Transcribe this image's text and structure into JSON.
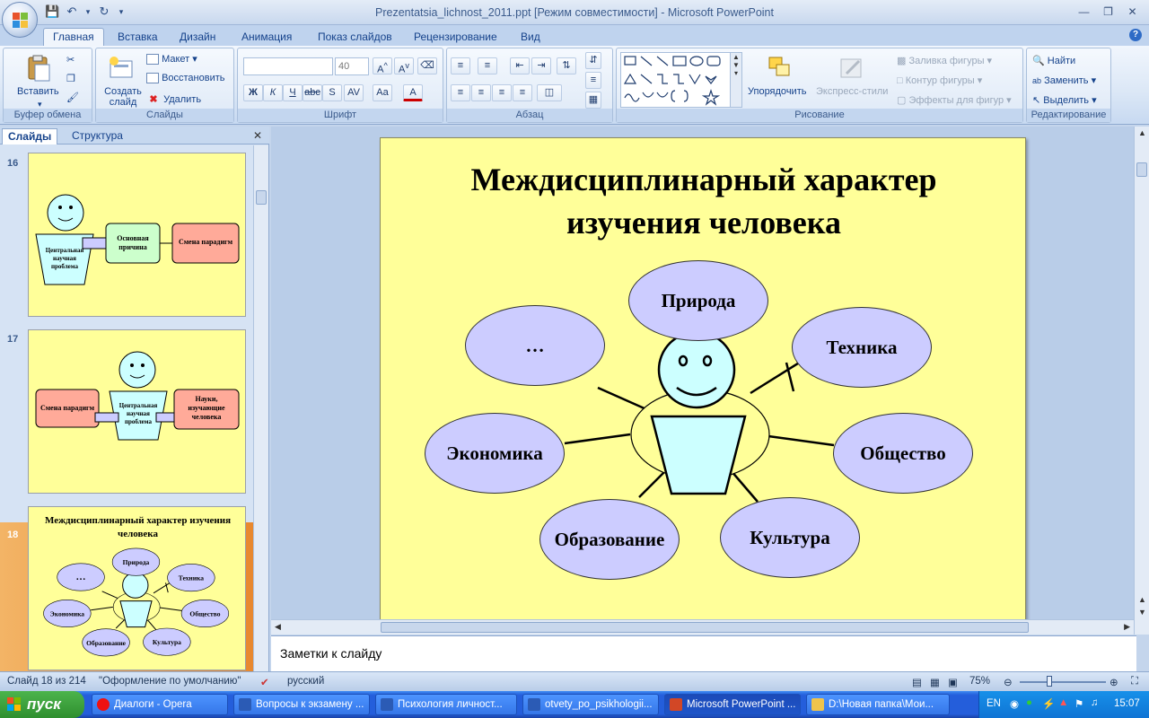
{
  "window": {
    "title": "Prezentatsia_lichnost_2011.ppt [Режим совместимости] - Microsoft PowerPoint"
  },
  "ribbon_tabs": [
    "Главная",
    "Вставка",
    "Дизайн",
    "Анимация",
    "Показ слайдов",
    "Рецензирование",
    "Вид"
  ],
  "ribbon": {
    "clipboard": {
      "paste": "Вставить",
      "label": "Буфер обмена"
    },
    "slides": {
      "new_slide": "Создать слайд",
      "layout": "Макет",
      "reset": "Восстановить",
      "delete": "Удалить",
      "label": "Слайды"
    },
    "font": {
      "font_name": "",
      "font_size": "40",
      "label": "Шрифт"
    },
    "paragraph": {
      "label": "Абзац"
    },
    "drawing": {
      "arrange": "Упорядочить",
      "quick_styles": "Экспресс-стили",
      "fill": "Заливка фигуры",
      "outline": "Контур фигуры",
      "effects": "Эффекты для фигур",
      "label": "Рисование"
    },
    "editing": {
      "find": "Найти",
      "replace": "Заменить",
      "select": "Выделить",
      "label": "Редактирование"
    }
  },
  "left_pane": {
    "tab_slides": "Слайды",
    "tab_outline": "Структура",
    "thumbs": [
      {
        "number": "16",
        "problem": "Центральная научная проблема",
        "cause": "Основная причина",
        "paradigm": "Смена парадигм"
      },
      {
        "number": "17",
        "paradigm": "Смена парадигм",
        "problem": "Центральная научная проблема",
        "sciences": "Науки, изучающие человека"
      },
      {
        "number": "18",
        "title": "Междисциплинарный характер изучения человека"
      }
    ]
  },
  "slide": {
    "title_line1": "Междисциплинарный характер",
    "title_line2": "изучения человека",
    "nodes": {
      "nature": "Природа",
      "technology": "Техника",
      "society": "Общество",
      "culture": "Культура",
      "education": "Образование",
      "economics": "Экономика",
      "other": "…"
    }
  },
  "notes": {
    "placeholder": "Заметки к слайду"
  },
  "status": {
    "slide_of": "Слайд 18 из 214",
    "theme": "\"Оформление по умолчанию\"",
    "language": "русский",
    "zoom": "75%"
  },
  "taskbar": {
    "start": "пуск",
    "tasks": [
      "Диалоги - Opera",
      "Вопросы к экзамену ...",
      "Психология личност...",
      "otvety_po_psikhologii...",
      "Microsoft PowerPoint ...",
      "D:\\Новая папка\\Мои..."
    ],
    "lang": "EN",
    "time": "15:07"
  },
  "colors": {
    "slide_bg": "#ffff99",
    "ellipse_fill": "#ccccff",
    "face_fill": "#ccffff",
    "accent_orange": "#e8882e"
  }
}
